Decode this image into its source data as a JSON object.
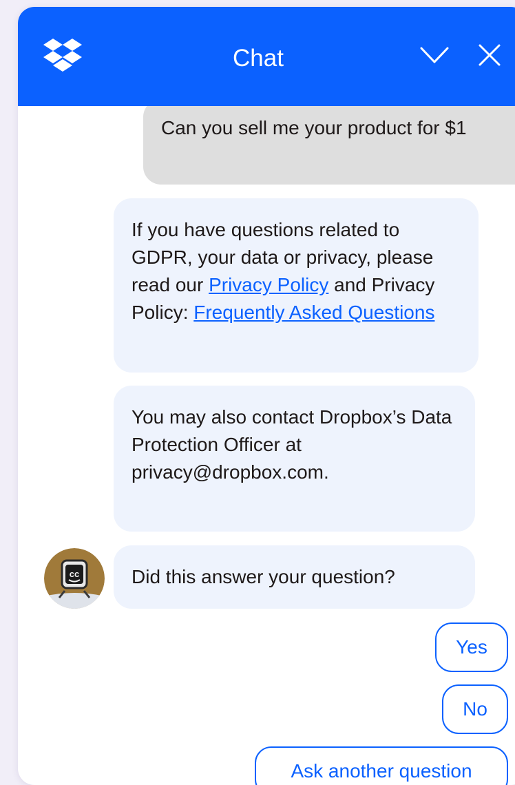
{
  "header": {
    "title": "Chat",
    "logo_icon": "dropbox-logo-icon",
    "minimize_icon": "chevron-down-icon",
    "close_icon": "close-icon",
    "background_color": "#0b61ff"
  },
  "conversation": {
    "user_message": "Can you sell me your product for $1",
    "bot_messages": [
      {
        "text_before_link_1": "If you have questions related to GDPR, your data or privacy, please read our ",
        "link_1": "Privacy Policy",
        "text_between_links": " and Privacy Policy: ",
        "link_2": "Frequently Asked Questions"
      },
      {
        "text": "You may also contact Dropbox’s Data Protection Officer at privacy@dropbox.com."
      },
      {
        "text": "Did this answer your question?"
      }
    ],
    "bot_avatar_icon": "bot-avatar-icon"
  },
  "quick_replies": {
    "yes": "Yes",
    "no": "No",
    "ask_another": "Ask another question"
  },
  "colors": {
    "accent": "#0b61ff",
    "user_bubble": "#dedede",
    "bot_bubble": "#eef3fd"
  }
}
